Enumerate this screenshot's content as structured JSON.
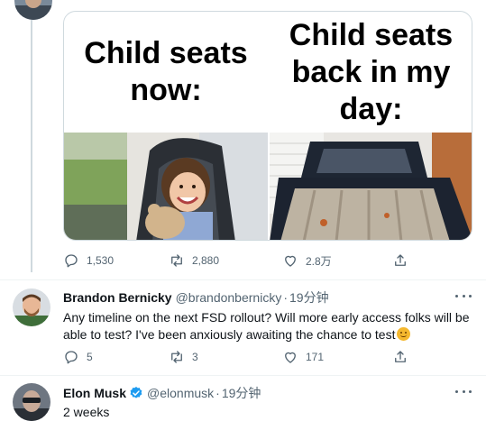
{
  "meme": {
    "left_caption": "Child seats now:",
    "right_caption": "Child seats back in my day:"
  },
  "parent_tweet": {
    "actions": {
      "replies": "1,530",
      "retweets": "2,880",
      "likes": "2.8万"
    }
  },
  "reply": {
    "name": "Brandon Bernicky",
    "handle": "@brandonbernicky",
    "separator": "·",
    "time": "19分钟",
    "text": "Any timeline on the next FSD rollout? Will more early access folks will be able to test? I've been anxiously awaiting the chance to test",
    "actions": {
      "replies": "5",
      "retweets": "3",
      "likes": "171"
    }
  },
  "last_tweet": {
    "name": "Elon Musk",
    "handle": "@elonmusk",
    "separator": "·",
    "time": "19分钟",
    "text": "2 weeks"
  },
  "icons": {
    "reply": "reply-icon",
    "retweet": "retweet-icon",
    "like": "like-icon",
    "share": "share-icon",
    "verified": "verified-badge-icon",
    "more": "more-options-icon"
  },
  "colors": {
    "verified": "#1d9bf0",
    "muted": "#536471",
    "line": "#cfd9de"
  }
}
